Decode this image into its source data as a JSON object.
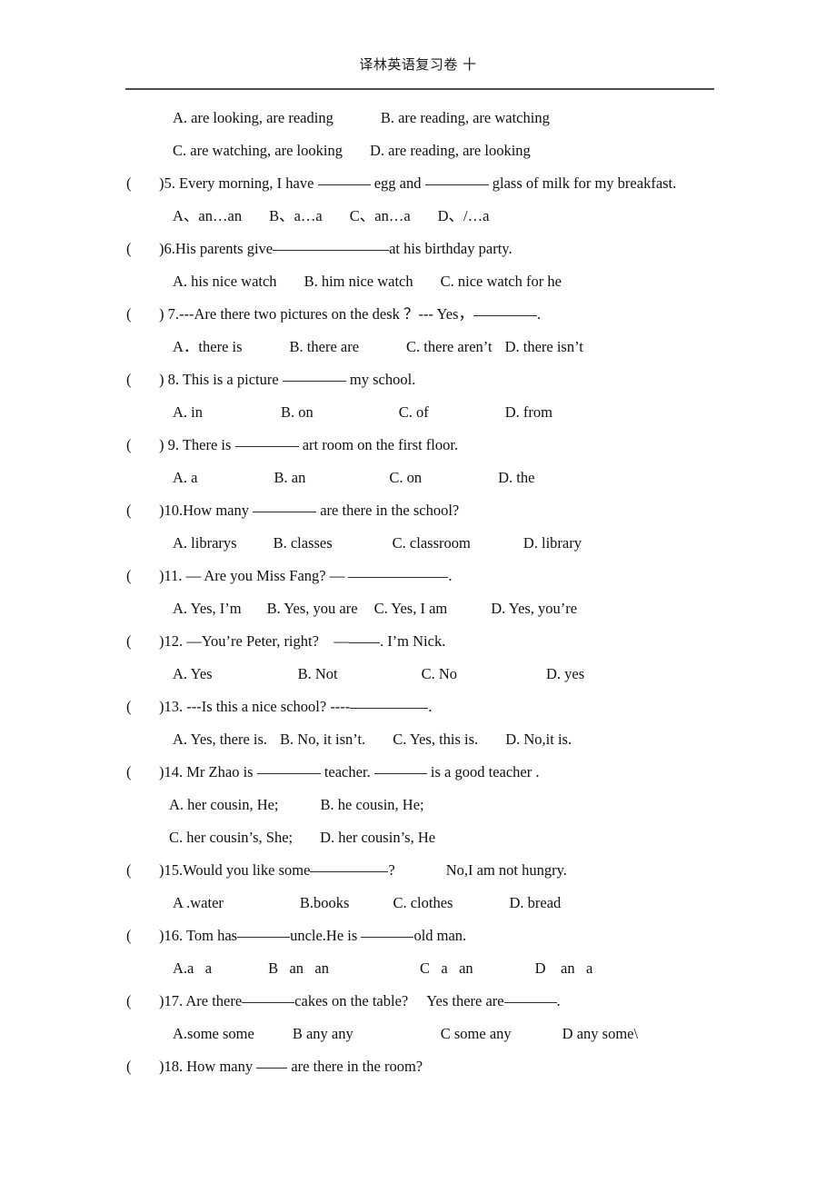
{
  "document": {
    "header_title": "译林英语复习卷  十",
    "rule_color": "#4d4d55"
  },
  "questions": [
    {
      "id": "q4-options",
      "kind": "options-only",
      "lines": [
        {
          "id": "q4-opt-ab",
          "parts": [
            "A. are looking, are reading",
            "B. are reading, are watching"
          ]
        },
        {
          "id": "q4-opt-cd",
          "parts": [
            "C. are watching, are looking",
            "D. are reading, are looking"
          ]
        }
      ]
    },
    {
      "id": "q5",
      "number": "5",
      "stem_a": ")5. Every morning, I have ",
      "stem_b": " egg and ",
      "stem_c": " glass of milk for my breakfast.",
      "options": [
        "A、an…an",
        "B、a…a",
        "C、an…a",
        "D、/…a"
      ]
    },
    {
      "id": "q6",
      "number": "6",
      "stem_a": ")6.His parents give",
      "stem_b": "at his birthday party.",
      "options": [
        "A. his nice watch",
        "B. him nice watch",
        "C. nice watch for he"
      ]
    },
    {
      "id": "q7",
      "number": "7",
      "stem_a": ") 7.---Are there two pictures on the desk ？--- Yes，",
      "stem_b": ".",
      "options": [
        "A．there is",
        "B. there are",
        "C. there aren’t",
        "D. there isn’t"
      ]
    },
    {
      "id": "q8",
      "number": "8",
      "stem_a": ") 8. This is a picture ",
      "stem_b": " my school.",
      "options": [
        "A. in",
        "B. on",
        "C. of",
        "D. from"
      ]
    },
    {
      "id": "q9",
      "number": "9",
      "stem_a": ") 9. There is ",
      "stem_b": " art room on the first floor.",
      "options": [
        "A. a",
        "B. an",
        "C. on",
        "D. the"
      ]
    },
    {
      "id": "q10",
      "number": "10",
      "stem_a": ")10.How many ",
      "stem_b": " are there in the school?",
      "options": [
        "A. librarys",
        "B. classes",
        "C. classroom",
        "D. library"
      ]
    },
    {
      "id": "q11",
      "number": "11",
      "stem_a": ")11. — Are you Miss Fang? — ",
      "stem_b": ".",
      "options": [
        "A. Yes, I’m",
        "B. Yes, you are",
        "C. Yes, I am",
        "D. Yes, you’re"
      ]
    },
    {
      "id": "q12",
      "number": "12",
      "stem_a": ")12. —You’re Peter, right?    —",
      "stem_b": ". I’m Nick.",
      "options": [
        "A. Yes",
        "B. Not",
        "C. No",
        "D. yes"
      ]
    },
    {
      "id": "q13",
      "number": "13",
      "stem_a": ")13. ---Is this a nice school? ----",
      "stem_b": ".",
      "options": [
        "A. Yes, there is.",
        "B. No, it isn’t.",
        "C. Yes, this is.",
        "D. No,it is."
      ]
    },
    {
      "id": "q14",
      "number": "14",
      "stem_a": ")14. Mr Zhao is ",
      "stem_b": " teacher. ",
      "stem_c": " is a good teacher .",
      "options_row1": [
        "A. her cousin, He;",
        "B. he cousin, He;"
      ],
      "options_row2": [
        "C. her cousin’s, She;",
        "D. her cousin’s, He"
      ]
    },
    {
      "id": "q15",
      "number": "15",
      "stem_a": ")15.Would you like some",
      "stem_b": "?",
      "stem_c": "No,I am not hungry.",
      "options": [
        "A .water",
        "B.books",
        "C. clothes",
        "D. bread"
      ]
    },
    {
      "id": "q16",
      "number": "16",
      "stem_a": ")16. Tom has",
      "stem_b": "uncle.He is ",
      "stem_c": "old man.",
      "options": [
        "A.a   a",
        "B   an   an",
        "C   a   an",
        "D    an   a"
      ]
    },
    {
      "id": "q17",
      "number": "17",
      "stem_a": ")17. Are there",
      "stem_b": "cakes on the table?     Yes there are",
      "stem_c": ".",
      "options": [
        "A.some some",
        "B any any",
        "C some any",
        "D any some\\"
      ]
    },
    {
      "id": "q18",
      "number": "18",
      "stem_a": ")18. How many ",
      "stem_b": " are there in the room?"
    }
  ],
  "symbols": {
    "paren_open": "(",
    "paren_close": ")"
  }
}
